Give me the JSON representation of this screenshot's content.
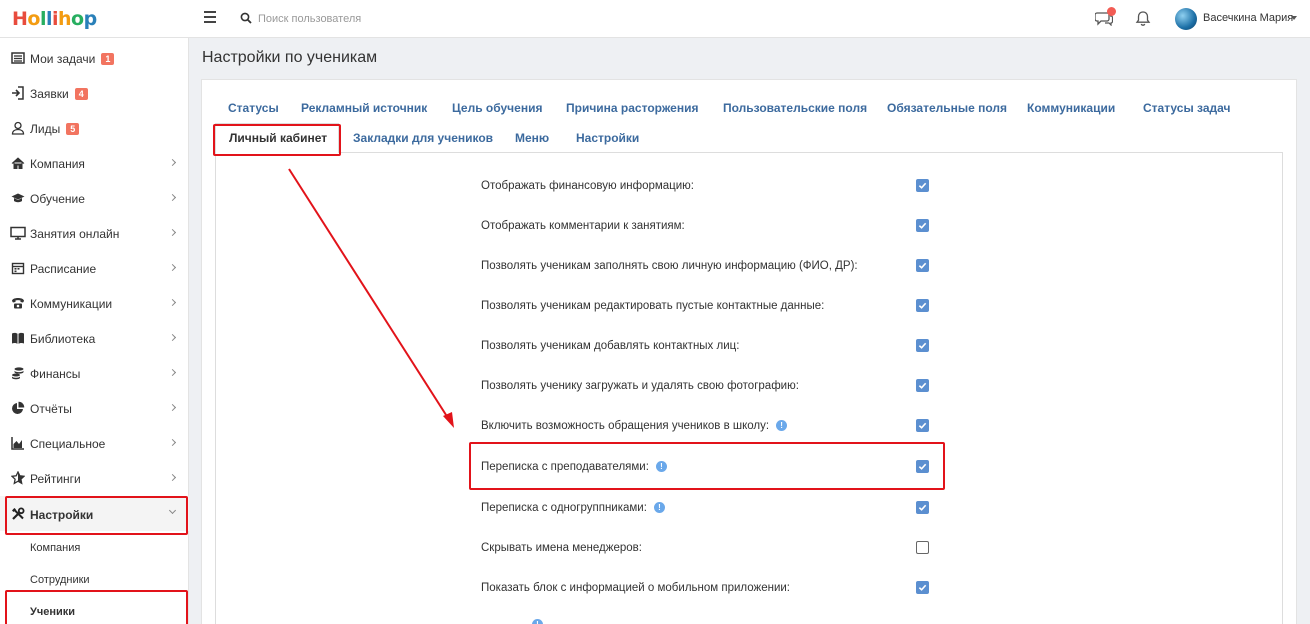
{
  "brand": {
    "logo_letters": [
      "H",
      "o",
      "l",
      "l",
      "i",
      "h",
      "o",
      "p"
    ]
  },
  "header": {
    "search_placeholder": "Поиск пользователя",
    "user_name": "Васечкина Мария"
  },
  "sidebar": {
    "items": [
      {
        "label": "Мои задачи",
        "badge": "1",
        "icon": "tasks-icon"
      },
      {
        "label": "Заявки",
        "badge": "4",
        "icon": "sign-in-icon"
      },
      {
        "label": "Лиды",
        "badge": "5",
        "icon": "user-icon"
      },
      {
        "label": "Компания",
        "icon": "home-icon"
      },
      {
        "label": "Обучение",
        "icon": "graduation-cap-icon"
      },
      {
        "label": "Занятия онлайн",
        "icon": "monitor-icon"
      },
      {
        "label": "Расписание",
        "icon": "calendar-icon"
      },
      {
        "label": "Коммуникации",
        "icon": "phone-icon"
      },
      {
        "label": "Библиотека",
        "icon": "book-icon"
      },
      {
        "label": "Финансы",
        "icon": "coins-icon"
      },
      {
        "label": "Отчёты",
        "icon": "pie-chart-icon"
      },
      {
        "label": "Специальное",
        "icon": "area-chart-icon"
      },
      {
        "label": "Рейтинги",
        "icon": "star-icon"
      },
      {
        "label": "Настройки",
        "icon": "tools-icon"
      }
    ],
    "sub_items": [
      "Компания",
      "Сотрудники",
      "Ученики"
    ]
  },
  "page": {
    "title": "Настройки по ученикам"
  },
  "tabs": {
    "row1": [
      "Статусы",
      "Рекламный источник",
      "Цель обучения",
      "Причина расторжения",
      "Пользовательские поля",
      "Обязательные поля",
      "Коммуникации",
      "Статусы задач"
    ],
    "row2": [
      "Личный кабинет",
      "Закладки для учеников",
      "Меню",
      "Настройки"
    ],
    "active": "Личный кабинет"
  },
  "settings": [
    {
      "label": "Отображать финансовую информацию:",
      "checked": true,
      "info": false
    },
    {
      "label": "Отображать комментарии к занятиям:",
      "checked": true,
      "info": false
    },
    {
      "label": "Позволять ученикам заполнять свою личную информацию (ФИО, ДР):",
      "checked": true,
      "info": false
    },
    {
      "label": "Позволять ученикам редактировать пустые контактные данные:",
      "checked": true,
      "info": false
    },
    {
      "label": "Позволять ученикам добавлять контактных лиц:",
      "checked": true,
      "info": false
    },
    {
      "label": "Позволять ученику загружать и удалять свою фотографию:",
      "checked": true,
      "info": false
    },
    {
      "label": "Включить возможность обращения учеников в школу:",
      "checked": true,
      "info": true
    },
    {
      "label": "Переписка с преподавателями:",
      "checked": true,
      "info": true
    },
    {
      "label": "Переписка с одногруппниками:",
      "checked": true,
      "info": true
    },
    {
      "label": "Скрывать имена менеджеров:",
      "checked": false,
      "info": false
    },
    {
      "label": "Показать блок с информацией о мобильном приложении:",
      "checked": true,
      "info": false
    }
  ],
  "colors": {
    "accent": "#3c6a9e",
    "highlight": "#e2131a",
    "checkbox": "#5b8fd0",
    "badge": "#f27460"
  }
}
